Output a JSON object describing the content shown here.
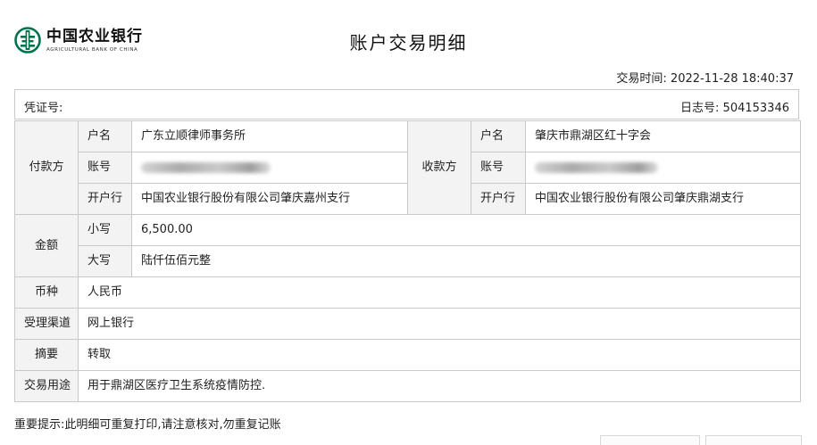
{
  "bank": {
    "name_cn": "中国农业银行",
    "name_en": "AGRICULTURAL BANK OF CHINA",
    "brand_color": "#00734a"
  },
  "title": "账户交易明细",
  "transaction_time": "交易时间: 2022-11-28 18:40:37",
  "voucher_label": "凭证号:",
  "log_number": "日志号: 504153346",
  "payer": {
    "section_label": "付款方",
    "name_label": "户名",
    "name": "广东立顺律师事务所",
    "account_label": "账号",
    "account_masked": true,
    "bank_label": "开户行",
    "bank": "中国农业银行股份有限公司肇庆嘉州支行"
  },
  "payee": {
    "section_label": "收款方",
    "name_label": "户名",
    "name": "肇庆市鼎湖区红十字会",
    "account_label": "账号",
    "account_masked": true,
    "bank_label": "开户行",
    "bank": "中国农业银行股份有限公司肇庆鼎湖支行"
  },
  "amount": {
    "label": "金额",
    "lower_label": "小写",
    "lower_value": "6,500.00",
    "upper_label": "大写",
    "upper_value": "陆仟伍佰元整"
  },
  "currency": {
    "label": "币种",
    "value": "人民币"
  },
  "channel": {
    "label": "受理渠道",
    "value": "网上银行"
  },
  "summary": {
    "label": "摘要",
    "value": "转取"
  },
  "purpose": {
    "label": "交易用途",
    "value": "用于鼎湖区医疗卫生系统疫情防控."
  },
  "notice": "重要提示:此明细可重复打印,请注意核对,勿重复记账"
}
